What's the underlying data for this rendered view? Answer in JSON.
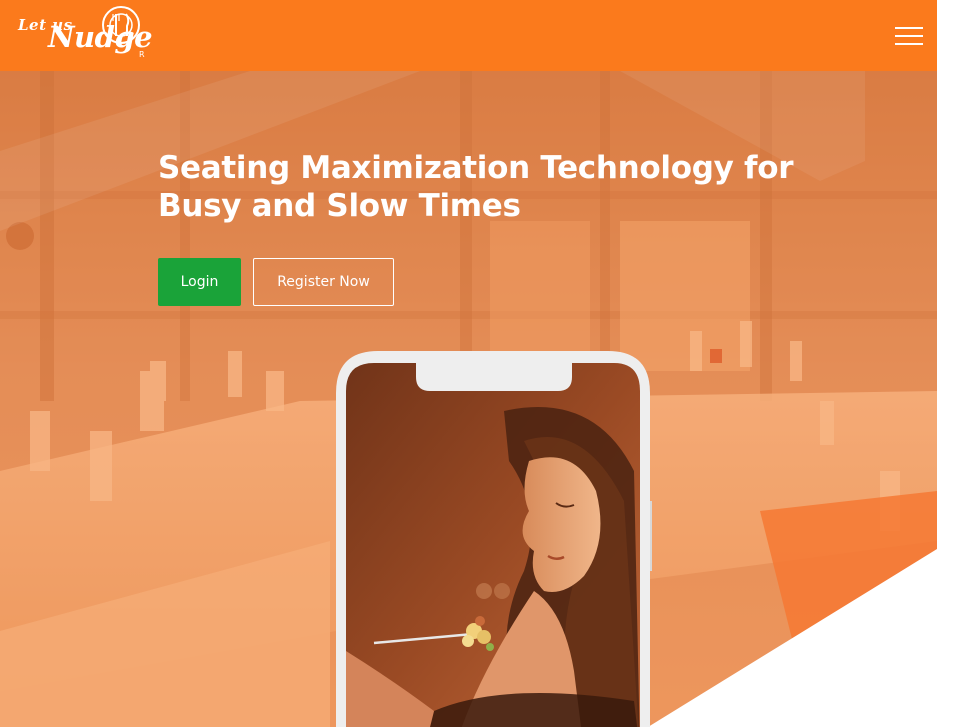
{
  "header": {
    "logo_small": "Let us",
    "logo_big": "Nudge",
    "logo_reg": "R",
    "menu_icon": "hamburger-menu-icon"
  },
  "hero": {
    "title": "Seating Maximization Technology for Busy and Slow Times",
    "login_label": "Login",
    "register_label": "Register Now"
  },
  "colors": {
    "brand_orange": "#fb7a1c",
    "login_green": "#1aa339",
    "white": "#ffffff"
  }
}
